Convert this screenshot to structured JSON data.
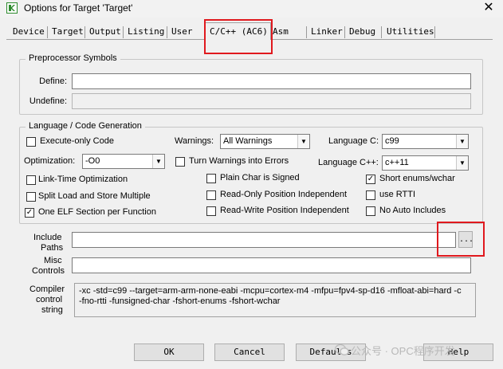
{
  "window": {
    "title": "Options for Target 'Target'",
    "close_glyph": "✕"
  },
  "tabs": [
    {
      "label": "Device"
    },
    {
      "label": "Target"
    },
    {
      "label": "Output"
    },
    {
      "label": "Listing"
    },
    {
      "label": "User"
    },
    {
      "label": "C/C++ (AC6)",
      "active": true
    },
    {
      "label": "Asm"
    },
    {
      "label": "Linker"
    },
    {
      "label": "Debug"
    },
    {
      "label": "Utilities"
    }
  ],
  "preprocessor": {
    "title": "Preprocessor Symbols",
    "define_label": "Define:",
    "define_value": "",
    "undefine_label": "Undefine:",
    "undefine_value": ""
  },
  "language": {
    "title": "Language / Code Generation",
    "execute_only": {
      "label": "Execute-only Code",
      "checked": false
    },
    "warnings_label": "Warnings:",
    "warnings_value": "All Warnings",
    "language_c_label": "Language C:",
    "language_c_value": "c99",
    "optimization_label": "Optimization:",
    "optimization_value": "-O0",
    "warnings_errors": {
      "label": "Turn Warnings into Errors",
      "checked": false
    },
    "language_cpp_label": "Language C++:",
    "language_cpp_value": "c++11",
    "lto": {
      "label": "Link-Time Optimization",
      "checked": false
    },
    "plain_char": {
      "label": "Plain Char is Signed",
      "checked": false
    },
    "short_enums": {
      "label": "Short enums/wchar",
      "checked": true
    },
    "split_load": {
      "label": "Split Load and Store Multiple",
      "checked": false
    },
    "ropi": {
      "label": "Read-Only Position Independent",
      "checked": false
    },
    "rtti": {
      "label": "use RTTI",
      "checked": false
    },
    "one_elf": {
      "label": "One ELF Section per Function",
      "checked": true
    },
    "rwpi": {
      "label": "Read-Write Position Independent",
      "checked": false
    },
    "no_auto_includes": {
      "label": "No Auto Includes",
      "checked": false
    },
    "check_glyph": "✓",
    "dropdown_glyph": "▼"
  },
  "paths": {
    "include_label_1": "Include",
    "include_label_2": "Paths",
    "include_value": "",
    "browse_label": "...",
    "misc_label_1": "Misc",
    "misc_label_2": "Controls",
    "misc_value": ""
  },
  "compiler": {
    "label_1": "Compiler",
    "label_2": "control",
    "label_3": "string",
    "line_1": "-xc -std=c99 --target=arm-arm-none-eabi -mcpu=cortex-m4 -mfpu=fpv4-sp-d16 -mfloat-abi=hard -c",
    "line_2": "-fno-rtti -funsigned-char -fshort-enums -fshort-wchar"
  },
  "buttons": {
    "ok": "OK",
    "cancel": "Cancel",
    "defaults": "Defaults",
    "help": "Help"
  },
  "watermark": "公众号 · OPC程序开发",
  "colors": {
    "highlight": "#e0191e",
    "dialog_bg": "#f0f0f0",
    "icon_green": "#2e8b2e"
  },
  "icons": {
    "app": "keil-window-icon",
    "watermark": "wechat-icon"
  }
}
